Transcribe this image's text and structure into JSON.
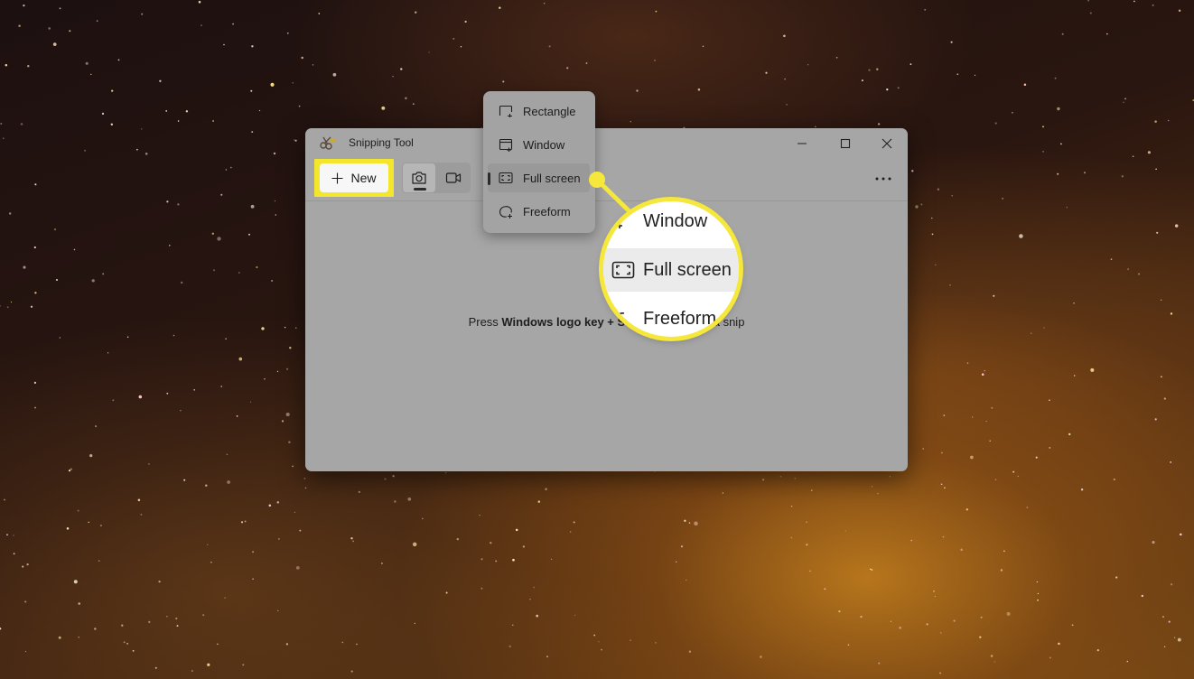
{
  "window": {
    "title": "Snipping Tool",
    "controls": [
      "minimize-icon",
      "maximize-icon",
      "close-icon"
    ]
  },
  "toolbar": {
    "new_label": "New",
    "modes": [
      {
        "name": "snip",
        "icon": "camera-icon",
        "selected": true
      },
      {
        "name": "record",
        "icon": "video-icon",
        "selected": false
      }
    ],
    "more_icon": "more-icon"
  },
  "hint": {
    "prefix": "Press ",
    "bold": "Windows logo key + Shi",
    "suffix": "a snip"
  },
  "snip_menu": {
    "items": [
      {
        "label": "Rectangle",
        "icon": "rectangle-snip-icon",
        "selected": false
      },
      {
        "label": "Window",
        "icon": "window-snip-icon",
        "selected": false
      },
      {
        "label": "Full screen",
        "icon": "fullscreen-snip-icon",
        "selected": true
      },
      {
        "label": "Freeform",
        "icon": "freeform-snip-icon",
        "selected": false
      }
    ]
  },
  "magnifier": {
    "items": [
      "Window",
      "Full screen",
      "Freeform"
    ]
  },
  "colors": {
    "highlight": "#f3e62d",
    "window_bg": "#a6a6a6"
  }
}
